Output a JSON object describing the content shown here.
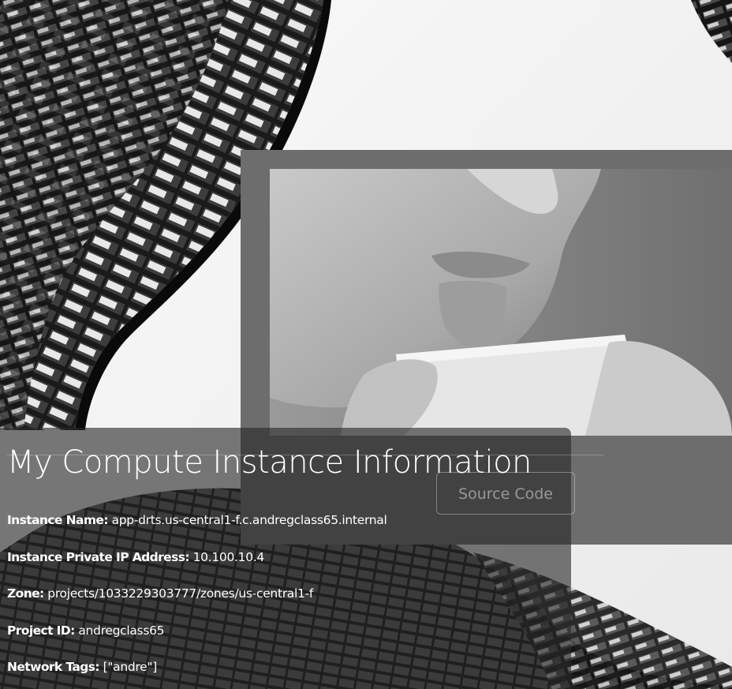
{
  "page": {
    "title": "My Compute Instance Information",
    "source_button": "Source Code"
  },
  "instance": {
    "name_label": "Instance Name:",
    "name_value": "app-drts.us-central1-f.c.andregclass65.internal",
    "ip_label": "Instance Private IP Address:",
    "ip_value": "10.100.10.4",
    "zone_label": "Zone:",
    "zone_value": "projects/1033229303777/zones/us-central1-f",
    "project_label": "Project ID:",
    "project_value": "andregclass65",
    "tags_label": "Network Tags:",
    "tags_value": "[\"andre\"]"
  },
  "colors": {
    "text": "#ffffff",
    "card_bg": "rgba(40,40,40,0.62)",
    "photo_frame": "#6d6d6d"
  }
}
